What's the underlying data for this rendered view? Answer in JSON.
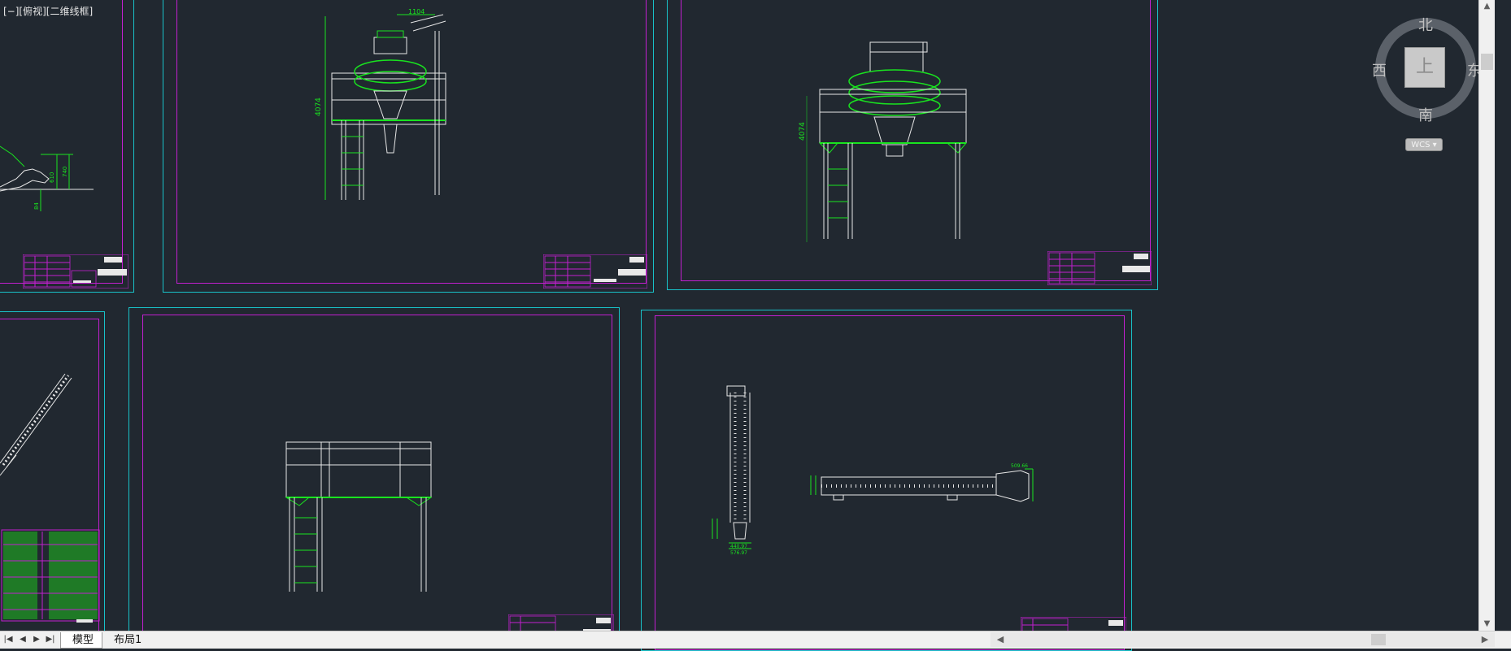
{
  "viewport": {
    "label": "[−][俯视][二维线框]"
  },
  "viewcube": {
    "north": "北",
    "south": "南",
    "east": "东",
    "west": "西",
    "top_face": "上",
    "wcs": "WCS"
  },
  "layout_tabs": {
    "model": "模型",
    "layout1": "布局1"
  },
  "dimensions": {
    "height_a": "4074",
    "height_b": "4074",
    "width_a": "1104",
    "small_a": "740",
    "small_b": "610",
    "small_c": "84",
    "bottom_a": "440.97",
    "bottom_b": "576.97",
    "right_dim": "509.66"
  },
  "colors": {
    "background": "#212830",
    "sheet_border": "#19c2c8",
    "inner_border": "#c21fd0",
    "geometry": "#e8e8e8",
    "dims": "#19e31f"
  }
}
